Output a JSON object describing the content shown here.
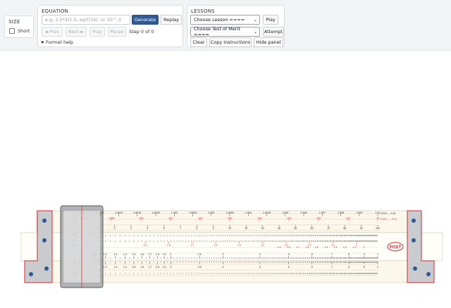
{
  "size": {
    "title": "SIZE",
    "short_label": "Short"
  },
  "equation": {
    "title": "EQUATION",
    "placeholder": "e.g. 2.5*3/1.5, sqrt(16), or 10^-3",
    "generate": "Generate",
    "replay": "Replay",
    "prev": "◄ Prev",
    "next": "Next ►",
    "play": "Play",
    "pause": "Pause",
    "step": "Step 0 of 0",
    "format_help": "Format help",
    "format_help_icon": "triangle-right-icon"
  },
  "lessons": {
    "title": "LESSONS",
    "lesson_select": "Choose Lesson ====",
    "play": "Play",
    "test_select": "Choose Test of Merit ====",
    "attempt": "Attempt",
    "clear": "Clear",
    "copy": "Copy instructions",
    "hide": "Hide panel"
  },
  "rule": {
    "brand": "POST",
    "scale_labels": [
      "LL0",
      "LL0",
      "K",
      "DF",
      "CF",
      "CIF",
      "CI",
      "C",
      "D",
      "R1",
      "R2"
    ],
    "ll0_ticks": [
      "1.001",
      "1.0012",
      "1.0014",
      "1.0016",
      "1.0018",
      "1.002",
      "1.0025",
      "1.003",
      "1.0035",
      "1.004",
      "1.0045",
      "1.005",
      "1.006",
      "1.007",
      "1.008",
      "1.009",
      "1.01"
    ],
    "ll00_ticks": [
      ".999",
      ".9985",
      ".998",
      ".997",
      ".996",
      ".995",
      ".994",
      ".993",
      ".992",
      ".991",
      ".99"
    ],
    "right_ticks": [
      "0.001 — 0.01",
      "-0.001 — -0.01"
    ],
    "c_ticks": [
      "1",
      "1.1",
      "1.2",
      "1.3",
      "1.4",
      "1.5",
      "1.6",
      "1.7",
      "1.8",
      "1.9",
      "2",
      "2.5",
      "3",
      "4",
      "5",
      "6",
      "7",
      "8",
      "9",
      "1"
    ],
    "d_ticks": [
      "1",
      "1.1",
      "1.2",
      "1.3",
      "1.4",
      "1.5",
      "1.6",
      "1.7",
      "1.8",
      "1.9",
      "2",
      "2.5",
      "3",
      "4",
      "5",
      "6",
      "7",
      "8",
      "9",
      "1"
    ],
    "cif_ticks": [
      "1.9",
      "1.8",
      "1.7",
      "1.6",
      "1.5",
      "1.4",
      "1.3",
      "1.2",
      "1.1",
      "1"
    ],
    "k_ticks": [
      "1",
      "2",
      "3",
      "4",
      "5",
      "6",
      "7",
      "8",
      "9",
      "10",
      "20",
      "30",
      "40",
      "50",
      "60",
      "70",
      "80",
      "90",
      "100"
    ]
  },
  "colors": {
    "accent": "#2f5a93",
    "red": "#d4282d",
    "rule_body": "#fbf7ea",
    "cursor": "#6f7378"
  }
}
